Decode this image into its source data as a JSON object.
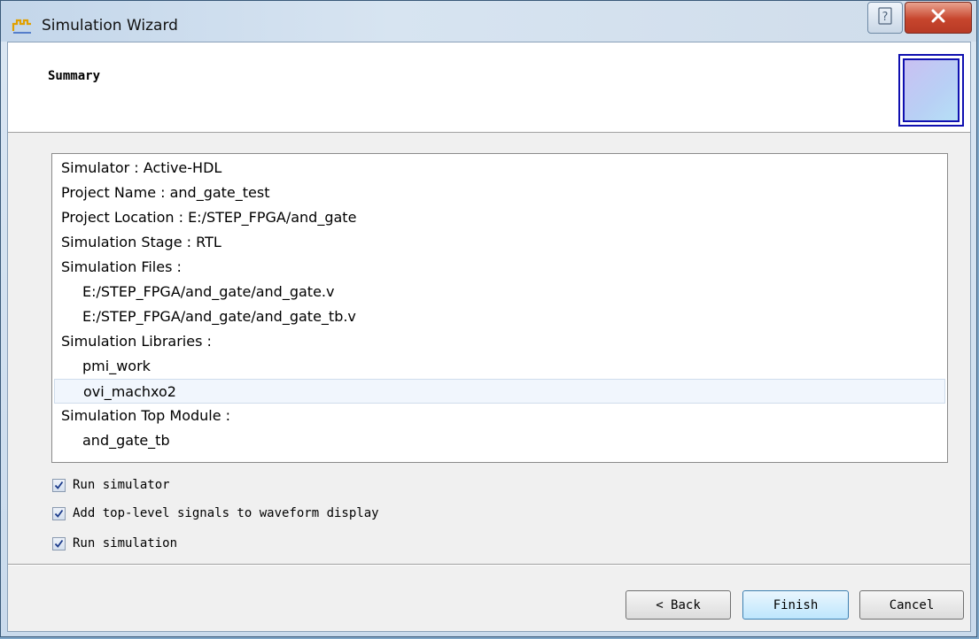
{
  "window": {
    "title": "Simulation Wizard"
  },
  "header": {
    "title": "Summary"
  },
  "summary": {
    "lines": [
      {
        "text": "Simulator : Active-HDL",
        "indent": false
      },
      {
        "text": "Project Name : and_gate_test",
        "indent": false
      },
      {
        "text": "Project Location : E:/STEP_FPGA/and_gate",
        "indent": false
      },
      {
        "text": "Simulation Stage : RTL",
        "indent": false
      },
      {
        "text": "Simulation Files :",
        "indent": false
      },
      {
        "text": "E:/STEP_FPGA/and_gate/and_gate.v",
        "indent": true
      },
      {
        "text": "E:/STEP_FPGA/and_gate/and_gate_tb.v",
        "indent": true
      },
      {
        "text": "Simulation Libraries :",
        "indent": false
      },
      {
        "text": "pmi_work",
        "indent": true
      },
      {
        "text": "ovi_machxo2",
        "indent": true,
        "selected": true
      },
      {
        "text": "Simulation Top Module :",
        "indent": false
      },
      {
        "text": "and_gate_tb",
        "indent": true
      }
    ]
  },
  "options": [
    {
      "label": "Run simulator",
      "checked": true
    },
    {
      "label": "Add top-level signals to waveform display",
      "checked": true
    },
    {
      "label": "Run simulation",
      "checked": true
    }
  ],
  "buttons": {
    "back": "< Back",
    "finish": "Finish",
    "cancel": "Cancel"
  },
  "colors": {
    "selection_bg": "#f1f6fd",
    "default_button": "#bee6fd",
    "close_button": "#c7452d"
  },
  "icons": {
    "app": "simulation-wizard-icon",
    "help": "help-icon",
    "close": "close-icon"
  }
}
